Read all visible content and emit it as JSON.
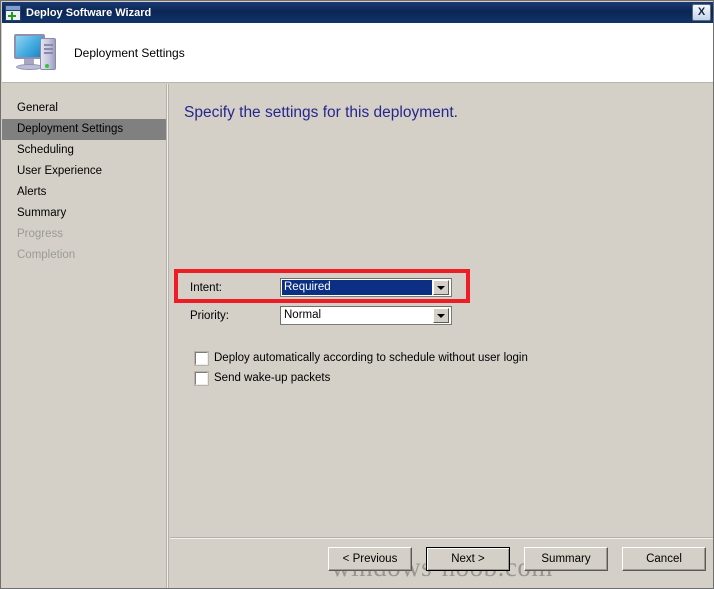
{
  "window": {
    "title": "Deploy Software Wizard",
    "title_icon": "wizard-window-plus-icon",
    "close_label": "X",
    "accent_titlebar_color": "#0a2555",
    "body_background": "#d4d0c8"
  },
  "header": {
    "icon": "computer-icon",
    "title": "Deployment Settings"
  },
  "sidebar": {
    "items": [
      {
        "label": "General",
        "state": "normal"
      },
      {
        "label": "Deployment Settings",
        "state": "selected"
      },
      {
        "label": "Scheduling",
        "state": "normal"
      },
      {
        "label": "User Experience",
        "state": "normal"
      },
      {
        "label": "Alerts",
        "state": "normal"
      },
      {
        "label": "Summary",
        "state": "normal"
      },
      {
        "label": "Progress",
        "state": "disabled"
      },
      {
        "label": "Completion",
        "state": "disabled"
      }
    ],
    "selected_color": "#808080",
    "disabled_color": "#9a9a94"
  },
  "content": {
    "heading": "Specify the settings for this deployment.",
    "heading_color": "#26268c",
    "fields": {
      "intent": {
        "label": "Intent:",
        "value": "Required",
        "focused": true,
        "highlight_color": "#0b2f82"
      },
      "priority": {
        "label": "Priority:",
        "value": "Normal",
        "focused": false
      }
    },
    "checkboxes": [
      {
        "label": "Deploy automatically according to schedule without user login",
        "checked": false
      },
      {
        "label": "Send wake-up packets",
        "checked": false
      }
    ],
    "annotation": {
      "type": "rectangle-highlight",
      "color": "#ee1c25",
      "targets": "intent"
    }
  },
  "footer": {
    "buttons": [
      {
        "label": "< Previous",
        "default": false
      },
      {
        "label": "Next >",
        "default": true
      },
      {
        "label": "Summary",
        "default": false
      },
      {
        "label": "Cancel",
        "default": false
      }
    ]
  },
  "watermark": {
    "text": "windows-noob.com",
    "color": "#9a968f"
  }
}
